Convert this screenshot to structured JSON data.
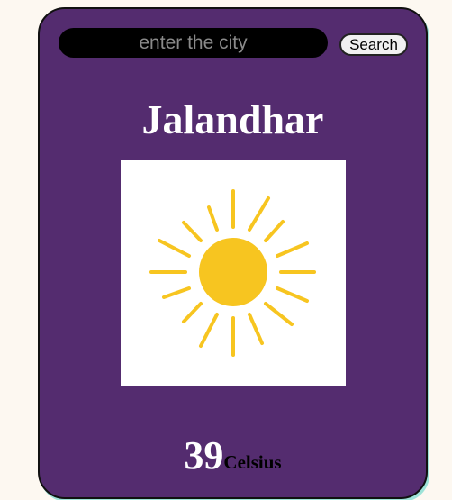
{
  "search": {
    "placeholder": "enter the city",
    "value": "",
    "button_label": "Search"
  },
  "weather": {
    "city": "Jalandhar",
    "condition_icon": "sun-icon",
    "temperature": "39",
    "unit": "Celsius"
  },
  "colors": {
    "page_background": "#fdf8f1",
    "card_background": "#542c6f",
    "sun": "#f7c520"
  }
}
